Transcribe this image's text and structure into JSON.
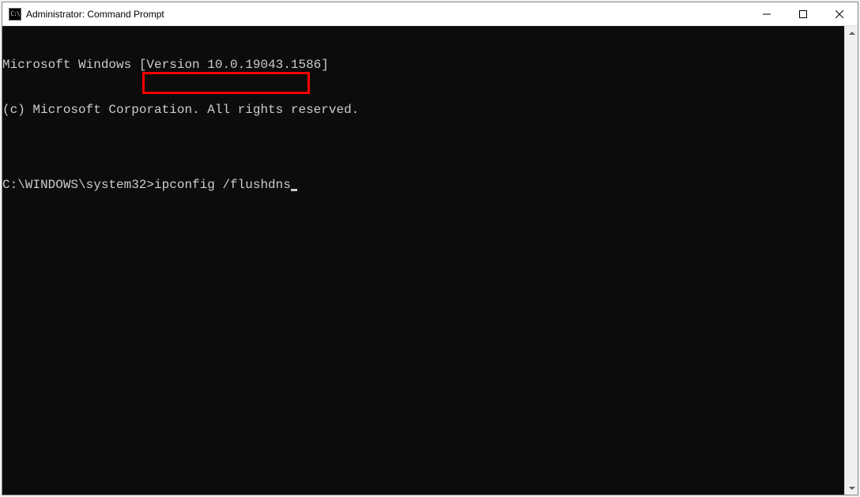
{
  "window": {
    "title": "Administrator: Command Prompt"
  },
  "terminal": {
    "line1": "Microsoft Windows [Version 10.0.19043.1586]",
    "line2": "(c) Microsoft Corporation. All rights reserved.",
    "blank": "",
    "prompt": "C:\\WINDOWS\\system32>",
    "command": "ipconfig /flushdns"
  }
}
